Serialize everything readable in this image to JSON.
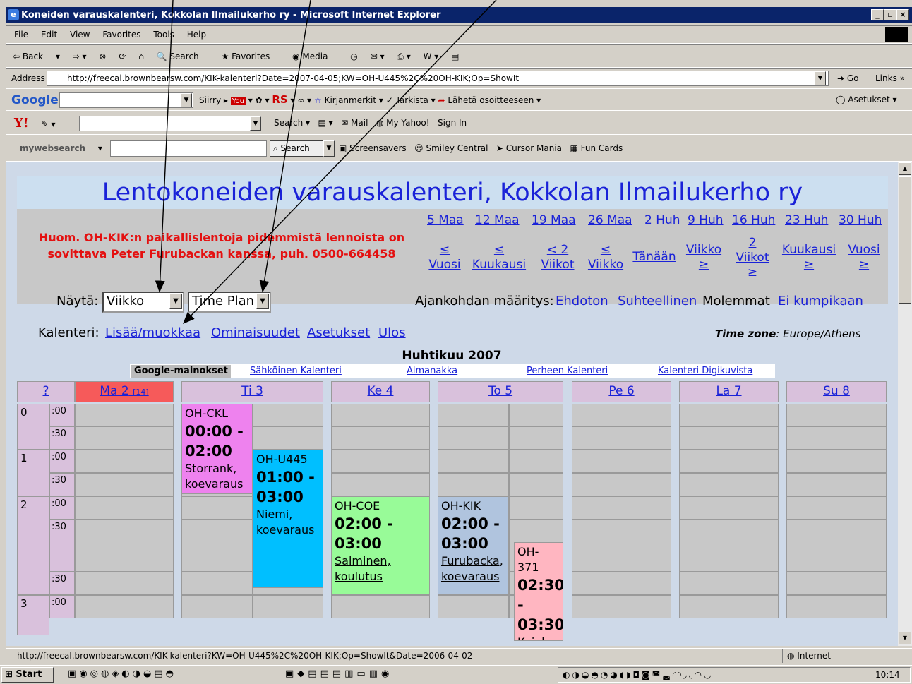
{
  "window": {
    "title": "Koneiden varauskalenteri, Kokkolan Ilmailukerho ry - Microsoft Internet Explorer"
  },
  "menu": [
    "File",
    "Edit",
    "View",
    "Favorites",
    "Tools",
    "Help"
  ],
  "toolbar": {
    "back": "Back",
    "search": "Search",
    "favorites": "Favorites",
    "media": "Media"
  },
  "address": {
    "label": "Address",
    "url": "http://freecal.brownbearsw.com/KIK-kalenteri?Date=2007-04-05;KW=OH-U445%2C%20OH-KIK;Op=ShowIt",
    "go": "Go",
    "links": "Links"
  },
  "google": {
    "logo": "Google",
    "siirry": "Siirry",
    "kirjanmerkit": "Kirjanmerkit",
    "tarkista": "Tarkista",
    "laheta": "Lähetä osoitteeseen",
    "asetukset": "Asetukset"
  },
  "yahoo": {
    "logo": "Y!",
    "search": "Search",
    "mail": "Mail",
    "myyahoo": "My Yahoo!",
    "signin": "Sign In"
  },
  "mws": {
    "logo": "mywebsearch",
    "search": "Search",
    "screensavers": "Screensavers",
    "smiley": "Smiley Central",
    "cursor": "Cursor Mania",
    "fun": "Fun Cards"
  },
  "page": {
    "banner": "Lentokoneiden varauskalenteri, Kokkolan Ilmailukerho ry",
    "note_line1": "Huom. OH-KIK:n paikallislentoja pidemmistä lennoista on",
    "note_line2": "sovittava Peter Furubackan kanssa, puh. 0500-664458",
    "nav_dates": [
      "5 Maa",
      "12 Maa",
      "19 Maa",
      "26 Maa",
      "2 Huh",
      "9 Huh",
      "16 Huh",
      "23 Huh",
      "30 Huh"
    ],
    "nav_vuosi_back": "Vuosi",
    "nav_kuukausi_back": "Kuukausi",
    "nav_2viikot_back": "Viikot",
    "nav_viikko_back": "Viikko",
    "nav_today": "Tänään",
    "nav_viikko_fwd": "Viikko",
    "nav_2viikot_fwd": "Viikot",
    "nav_kuukausi_fwd": "Kuukausi",
    "nav_vuosi_fwd": "Vuosi",
    "lt": "≤",
    "gt": "≥",
    "lt2": "< 2",
    "two": "2",
    "nayta_label": "Näytä:",
    "view_select": "Viikko",
    "plan_select": "Time Plan",
    "ajankohta_label": "Ajankohdan määritys:",
    "ehdoton": "Ehdoton",
    "suhteellinen": "Suhteellinen",
    "molemmat": "Molemmat",
    "ei_kumpikaan": "Ei kumpikaan",
    "kalenteri_label": "Kalenteri:",
    "lisaa": "Lisää/muokkaa",
    "ominaisuudet": "Ominaisuudet",
    "asetukset": "Asetukset",
    "ulos": "Ulos",
    "timezone_label": "Time zone",
    "timezone_value": ": Europe/Athens",
    "month": "Huhtikuu 2007",
    "ads": {
      "label": "Google-mainokset",
      "items": [
        "Sähköinen Kalenteri",
        "Almanakka",
        "Perheen Kalenteri",
        "Kalenteri Digikuvista"
      ]
    }
  },
  "calendar": {
    "help": "?",
    "days": [
      {
        "label": "Ma 2",
        "week": "[14]"
      },
      {
        "label": "Ti 3"
      },
      {
        "label": "Ke 4"
      },
      {
        "label": "To 5"
      },
      {
        "label": "Pe 6"
      },
      {
        "label": "La 7"
      },
      {
        "label": "Su 8"
      }
    ],
    "hours": [
      "0",
      "1",
      "2",
      "3"
    ],
    "minutes": [
      ":00",
      ":30"
    ],
    "events": [
      {
        "plane": "OH-CKL",
        "time": "00:00 - 02:00",
        "who": "Storrank, koevaraus",
        "color": "#ee82ee"
      },
      {
        "plane": "OH-U445",
        "time": "01:00 - 03:00",
        "who": "Niemi, koevaraus",
        "color": "#00bfff"
      },
      {
        "plane": "OH-COE",
        "time": "02:00 - 03:00",
        "who": "Salminen, koulutus",
        "color": "#98fb98"
      },
      {
        "plane": "OH-KIK",
        "time": "02:00 - 03:00",
        "who": "Furubacka, koevaraus",
        "color": "#b0c4de"
      },
      {
        "plane": "OH-371",
        "time": "02:30 - 03:30",
        "who": "Kujala",
        "color": "#ffb6c1"
      }
    ]
  },
  "status": {
    "url": "http://freecal.brownbearsw.com/KIK-kalenteri?KW=OH-U445%2C%20OH-KIK;Op=ShowIt&Date=2006-04-02",
    "zone": "Internet"
  },
  "taskbar": {
    "start": "Start",
    "clock": "10:14"
  }
}
